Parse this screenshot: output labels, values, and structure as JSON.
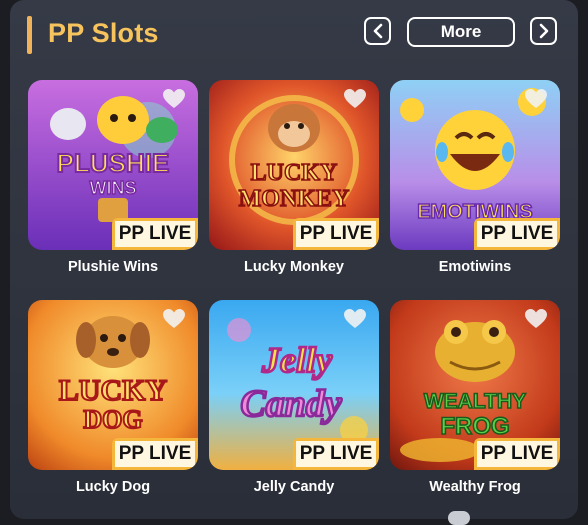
{
  "header": {
    "title": "PP Slots",
    "more_label": "More"
  },
  "games": [
    {
      "name": "Plushie Wins",
      "logo_line1": "PLUSHIE",
      "logo_line2": "WINS",
      "badge": "PP LIVE",
      "favorite": false
    },
    {
      "name": "Lucky Monkey",
      "logo_line1": "LUCKY",
      "logo_line2": "MONKEY",
      "badge": "PP LIVE",
      "favorite": false
    },
    {
      "name": "Emotiwins",
      "logo_line1": "EMOTIWINS",
      "logo_line2": "",
      "badge": "PP LIVE",
      "favorite": false
    },
    {
      "name": "Lucky Dog",
      "logo_line1": "LUCKY",
      "logo_line2": "DOG",
      "badge": "PP LIVE",
      "favorite": false
    },
    {
      "name": "Jelly Candy",
      "logo_line1": "Jelly",
      "logo_line2": "Candy",
      "badge": "PP LIVE",
      "favorite": false
    },
    {
      "name": "Wealthy Frog",
      "logo_line1": "WEALTHY",
      "logo_line2": "FROG",
      "badge": "PP LIVE",
      "favorite": false
    }
  ],
  "colors": {
    "accent": "#f6c35c",
    "badge": "#f5b73b",
    "panel": "#353a46"
  }
}
